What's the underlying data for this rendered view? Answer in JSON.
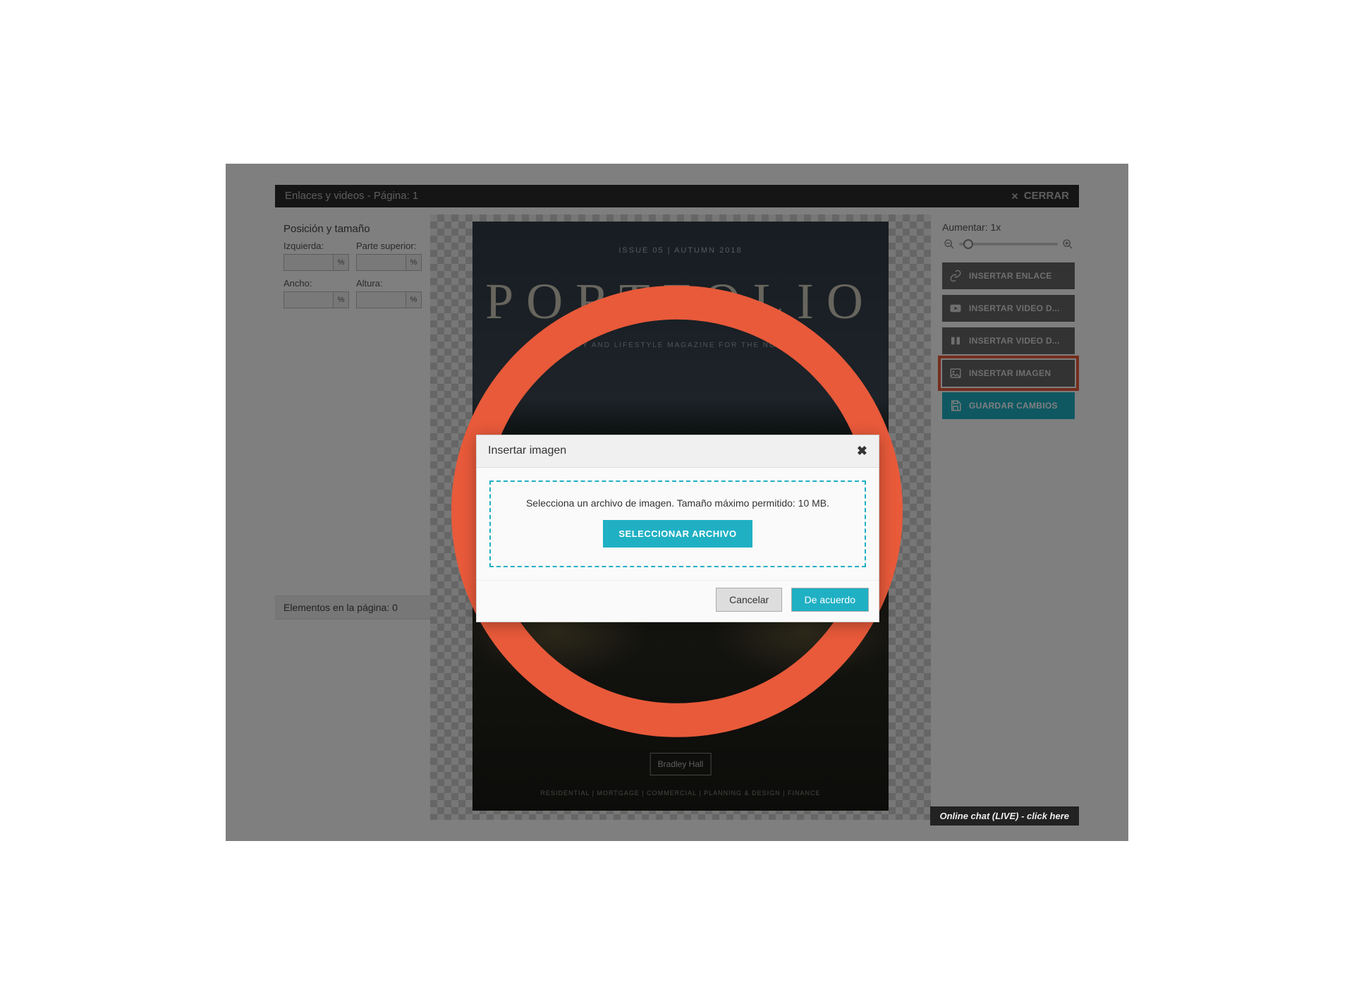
{
  "topbar": {
    "title": "Enlaces y videos - Página: 1",
    "close_label": "CERRAR"
  },
  "leftpanel": {
    "section_title": "Posición y tamaño",
    "fields": {
      "left_label": "Izquierda:",
      "top_label": "Parte superior:",
      "width_label": "Ancho:",
      "height_label": "Altura:",
      "unit": "%"
    },
    "elements_header": "Elementos en la página: 0"
  },
  "page_preview": {
    "issue": "ISSUE 05  |  AUTUMN 2018",
    "title": "PORTFOLIO",
    "subtitle": "PROPERTY AND LIFESTYLE MAGAZINE FOR THE NORTH EAST",
    "logo": "Bradley Hall",
    "footer": "RESIDENTIAL  |  MORTGAGE  |  COMMERCIAL  |  PLANNING & DESIGN  | FINANCE"
  },
  "rightpanel": {
    "zoom_label": "Aumentar: 1x",
    "buttons": {
      "link": "INSERTAR ENLACE",
      "video1": "INSERTAR VIDEO D...",
      "video2": "INSERTAR VIDEO D...",
      "image": "INSERTAR IMAGEN",
      "save": "GUARDAR CAMBIOS"
    }
  },
  "modal": {
    "title": "Insertar imagen",
    "instruction": "Selecciona un archivo de imagen. Tamaño máximo permitido: 10 MB.",
    "select_button": "SELECCIONAR ARCHIVO",
    "cancel": "Cancelar",
    "ok": "De acuerdo"
  },
  "chat": {
    "label": "Online chat (LIVE) - click here"
  }
}
